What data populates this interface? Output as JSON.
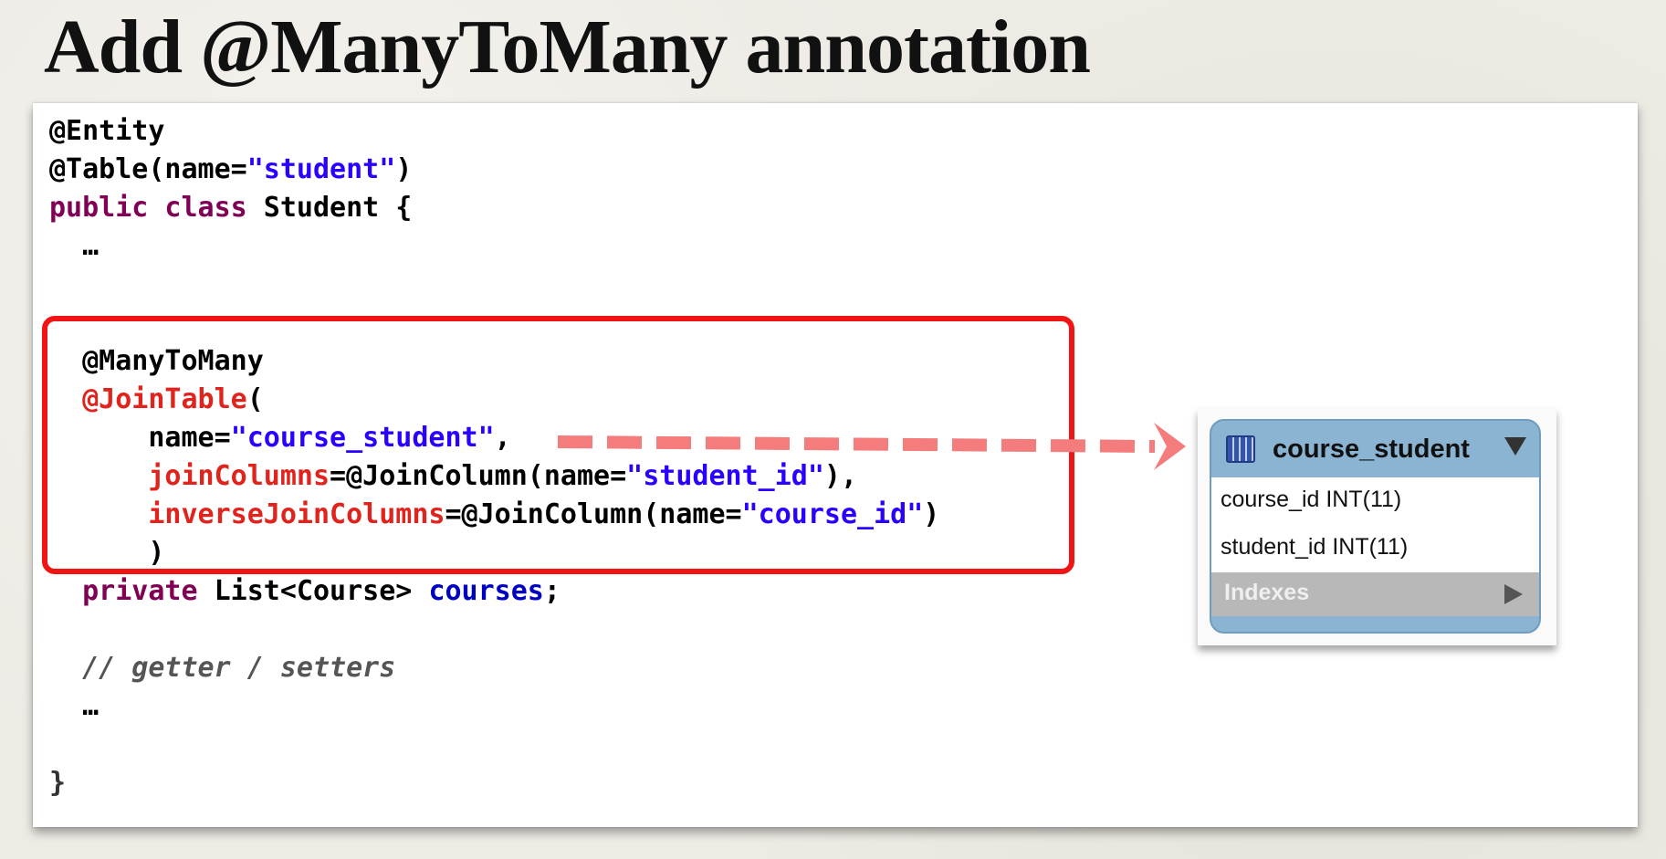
{
  "slide": {
    "title": "Add @ManyToMany annotation"
  },
  "colors": {
    "keyword": "#7f0055",
    "string": "#2a00ff",
    "annotation_attr": "#e0231c",
    "field": "#0000c0",
    "highlight_border": "#f01414",
    "arrow": "#f47c7c",
    "db_header": "#8ab4d2"
  },
  "code": {
    "line1": "@Entity",
    "line2_pre": "@Table(name=",
    "line2_str": "\"student\"",
    "line2_post": ")",
    "line3_kw": "public class",
    "line3_rest": " Student {",
    "line4": "  …",
    "line6": "  @ManyToMany",
    "line7_red": "  @JoinTable",
    "line7_post": "(",
    "line8_pre": "      name=",
    "line8_str": "\"course_student\"",
    "line8_post": ",",
    "line9_red": "      joinColumns",
    "line9_mid": "=@JoinColumn(name=",
    "line9_str": "\"student_id\"",
    "line9_post": "),",
    "line10_red": "      inverseJoinColumns",
    "line10_mid": "=@JoinColumn(name=",
    "line10_str": "\"course_id\"",
    "line10_post": ")",
    "line11": "      )",
    "line12_kw": "  private",
    "line12_mid": " List<Course> ",
    "line12_field": "courses",
    "line12_post": ";",
    "line14": "  // getter / setters",
    "line15": "  …",
    "line17": "}"
  },
  "db_table": {
    "name": "course_student",
    "icon": "table-icon",
    "columns": [
      "course_id INT(11)",
      "student_id INT(11)"
    ],
    "indexes_label": "Indexes"
  }
}
